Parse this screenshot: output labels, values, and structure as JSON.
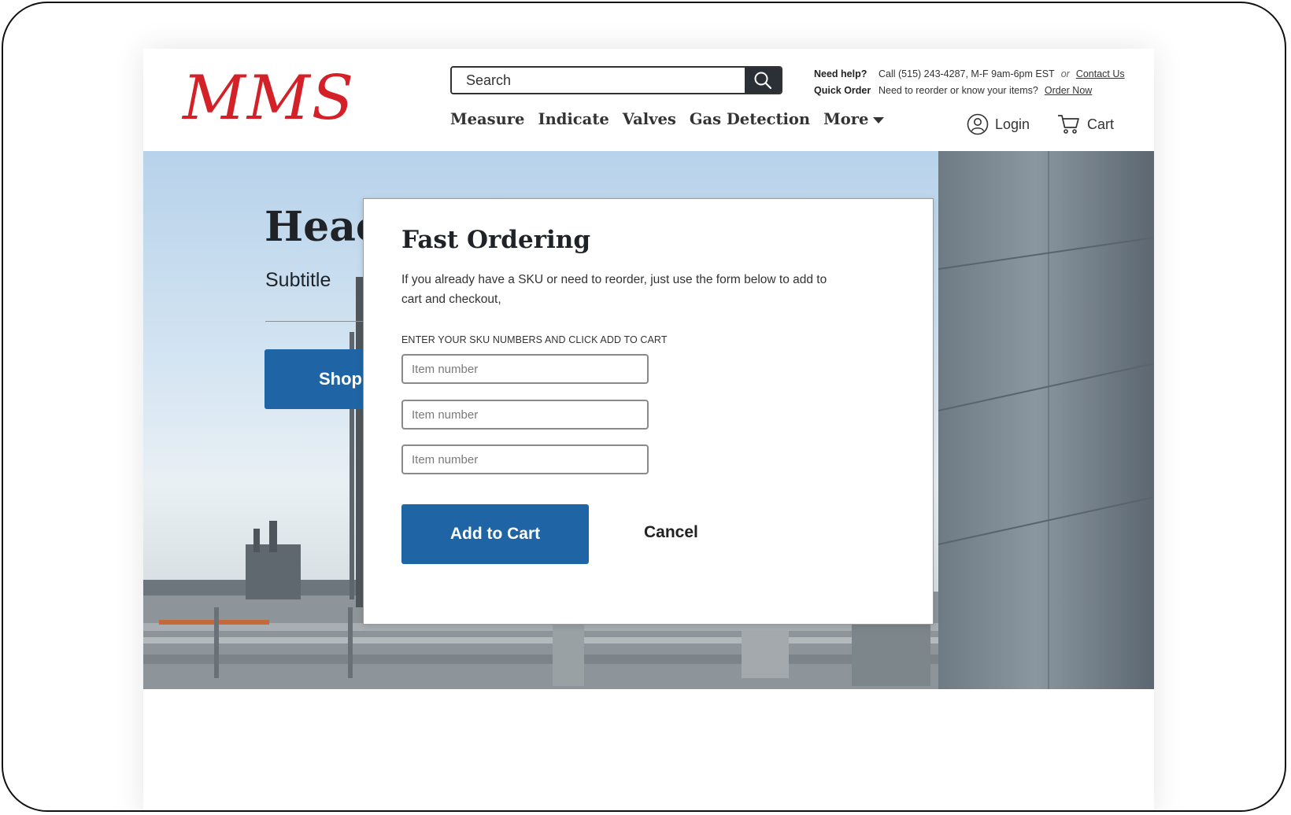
{
  "brand": {
    "logo_text": "MMS",
    "logo_color": "#d42027"
  },
  "search": {
    "placeholder": "Search"
  },
  "help": {
    "need_help_label": "Need help?",
    "need_help_text": "Call (515) 243-4287, M-F 9am-6pm EST",
    "or_text": "or",
    "contact_link": "Contact Us",
    "quick_order_label": "Quick Order",
    "quick_order_text": "Need to reorder or know your items?",
    "order_now_link": "Order Now"
  },
  "nav": {
    "items": [
      "Measure",
      "Indicate",
      "Valves",
      "Gas Detection",
      "More"
    ]
  },
  "account": {
    "login_label": "Login",
    "cart_label": "Cart"
  },
  "hero": {
    "title": "Heac",
    "subtitle": "Subtitle",
    "button_label": "Shop"
  },
  "modal": {
    "title": "Fast Ordering",
    "description": "If you already have a SKU or need to reorder, just use the form below to add to cart and checkout,",
    "label": "ENTER YOUR SKU NUMBERS AND CLICK ADD TO CART",
    "inputs": [
      {
        "placeholder": "Item number"
      },
      {
        "placeholder": "Item number"
      },
      {
        "placeholder": "Item number"
      }
    ],
    "add_button_label": "Add to Cart",
    "cancel_label": "Cancel"
  },
  "colors": {
    "primary_blue": "#1f65a5",
    "text_dark": "#1f2328"
  }
}
